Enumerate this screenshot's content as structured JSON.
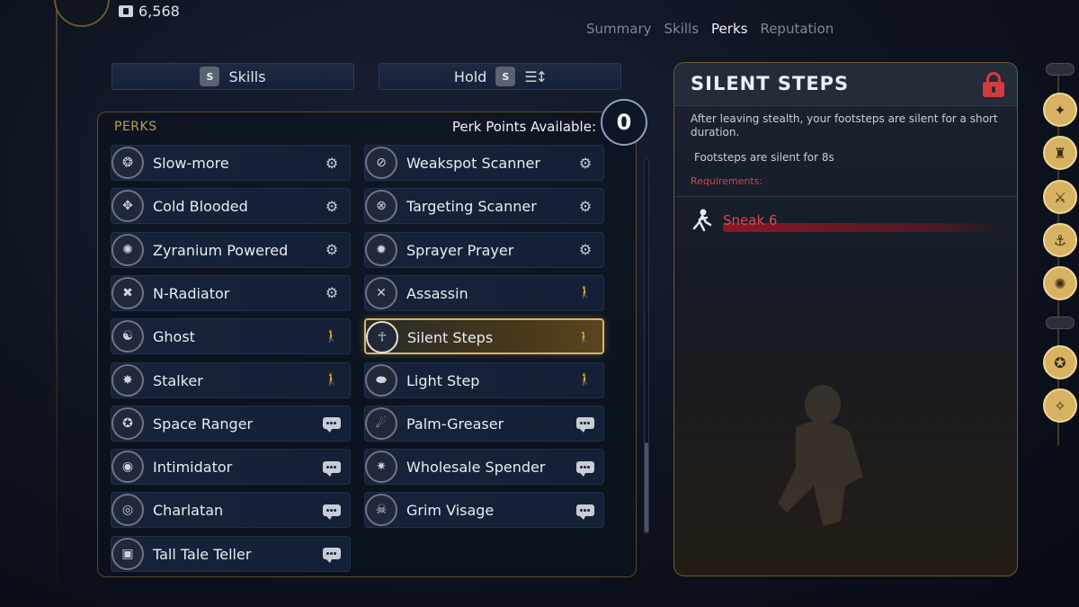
{
  "currency": {
    "amount": "6,568",
    "icon": "credits-icon"
  },
  "top_tabs": [
    {
      "label": "Summary",
      "active": false
    },
    {
      "label": "Skills",
      "active": false
    },
    {
      "label": "Perks",
      "active": true
    },
    {
      "label": "Reputation",
      "active": false
    }
  ],
  "skills_button": {
    "key": "S",
    "label": "Skills"
  },
  "hold_button": {
    "label": "Hold",
    "key": "S",
    "icon": "sort-icon"
  },
  "perks_panel": {
    "title": "PERKS",
    "points_label": "Perk Points Available:",
    "points_value": "0"
  },
  "perks_left": [
    {
      "label": "Slow-more",
      "category": "tech"
    },
    {
      "label": "Cold Blooded",
      "category": "tech"
    },
    {
      "label": "Zyranium Powered",
      "category": "tech"
    },
    {
      "label": "N-Radiator",
      "category": "tech"
    },
    {
      "label": "Ghost",
      "category": "stealth"
    },
    {
      "label": "Stalker",
      "category": "stealth"
    },
    {
      "label": "Space Ranger",
      "category": "speech"
    },
    {
      "label": "Intimidator",
      "category": "speech"
    },
    {
      "label": "Charlatan",
      "category": "speech"
    },
    {
      "label": "Tall Tale Teller",
      "category": "speech"
    }
  ],
  "perks_right": [
    {
      "label": "Weakspot Scanner",
      "category": "tech"
    },
    {
      "label": "Targeting Scanner",
      "category": "tech"
    },
    {
      "label": "Sprayer Prayer",
      "category": "tech"
    },
    {
      "label": "Assassin",
      "category": "stealth"
    },
    {
      "label": "Silent Steps",
      "category": "stealth",
      "selected": true
    },
    {
      "label": "Light Step",
      "category": "stealth"
    },
    {
      "label": "Palm-Greaser",
      "category": "speech"
    },
    {
      "label": "Wholesale Spender",
      "category": "speech"
    },
    {
      "label": "Grim Visage",
      "category": "speech"
    }
  ],
  "detail": {
    "title": "SILENT STEPS",
    "locked": true,
    "description": "After leaving stealth, your footsteps are silent for a short duration.",
    "effect": "Footsteps are silent for 8s",
    "requirements_label": "Requirements:",
    "requirement": {
      "label": "Sneak 6",
      "icon": "sneak-icon"
    }
  },
  "colors": {
    "accent_gold": "#d7b262",
    "requirement_red": "#e04848",
    "panel_border": "#5c4a28"
  }
}
